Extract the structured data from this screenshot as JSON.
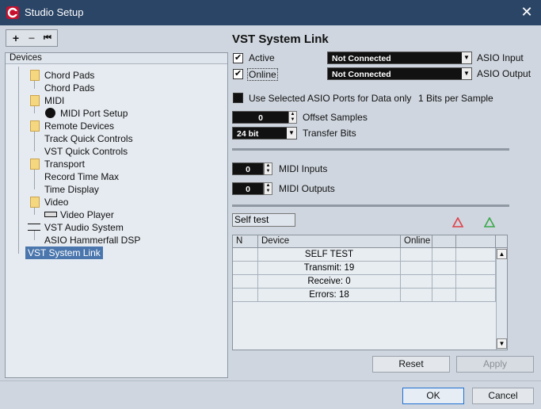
{
  "window": {
    "title": "Studio Setup",
    "close_glyph": "✕"
  },
  "toolbar": {
    "add": "+",
    "remove": "−",
    "reset": "⏮"
  },
  "tree": {
    "header": "Devices",
    "items": [
      {
        "label": "Chord Pads",
        "level": 1,
        "icon": "folder-icon"
      },
      {
        "label": "Chord Pads",
        "level": 2
      },
      {
        "label": "MIDI",
        "level": 1,
        "icon": "folder-icon"
      },
      {
        "label": "MIDI Port Setup",
        "level": 2,
        "icon": "midi-port-icon"
      },
      {
        "label": "Remote Devices",
        "level": 1,
        "icon": "folder-icon"
      },
      {
        "label": "Track Quick Controls",
        "level": 2
      },
      {
        "label": "VST Quick Controls",
        "level": 2
      },
      {
        "label": "Transport",
        "level": 1,
        "icon": "folder-icon"
      },
      {
        "label": "Record Time Max",
        "level": 2
      },
      {
        "label": "Time Display",
        "level": 2
      },
      {
        "label": "Video",
        "level": 1,
        "icon": "folder-icon"
      },
      {
        "label": "Video Player",
        "level": 2,
        "icon": "video-player-icon"
      },
      {
        "label": "VST Audio System",
        "level": 1,
        "icon": "audio-system-icon"
      },
      {
        "label": "ASIO Hammerfall DSP",
        "level": 2
      },
      {
        "label": "VST System Link",
        "level": 0,
        "selected": true
      }
    ]
  },
  "panel": {
    "title": "VST System Link",
    "active_label": "Active",
    "online_label": "Online",
    "asio_input_value": "Not Connected",
    "asio_input_label": "ASIO Input",
    "asio_output_value": "Not Connected",
    "asio_output_label": "ASIO Output",
    "use_selected_label": "Use Selected ASIO Ports for Data only",
    "bits_per_sample": "1 Bits per Sample",
    "offset_value": "0",
    "offset_label": "Offset Samples",
    "transfer_value": "24 bit",
    "transfer_label": "Transfer Bits",
    "midi_inputs_value": "0",
    "midi_inputs_label": "MIDI Inputs",
    "midi_outputs_value": "0",
    "midi_outputs_label": "MIDI Outputs",
    "selftest_label": "Self test",
    "table": {
      "columns": [
        "N",
        "Device",
        "Online",
        "",
        ""
      ],
      "rows": [
        {
          "n": "",
          "device": "SELF TEST"
        },
        {
          "n": "",
          "device": "Transmit:  19"
        },
        {
          "n": "",
          "device": "Receive:  0"
        },
        {
          "n": "",
          "device": "Errors:  18"
        }
      ]
    },
    "reset_button": "Reset",
    "apply_button": "Apply"
  },
  "footer": {
    "ok_button": "OK",
    "cancel_button": "Cancel"
  },
  "colors": {
    "accent": "#1f6fd1",
    "selection": "#4a76ad",
    "triangle_red": "#e0404a",
    "triangle_green": "#3aa84a"
  }
}
